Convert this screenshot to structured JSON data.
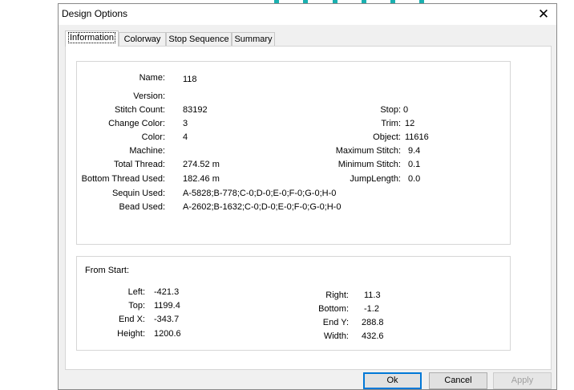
{
  "dialog": {
    "title": "Design Options",
    "close_icon": "close-icon"
  },
  "tabs": [
    {
      "label": "Information",
      "active": true
    },
    {
      "label": "Colorway",
      "active": false
    },
    {
      "label": "Stop Sequence",
      "active": false
    },
    {
      "label": "Summary",
      "active": false
    }
  ],
  "info": {
    "name": {
      "label": "Name:",
      "value": "118"
    },
    "version": {
      "label": "Version:",
      "value": ""
    },
    "stitch_count": {
      "label": "Stitch Count:",
      "value": "83192"
    },
    "change_color": {
      "label": "Change Color:",
      "value": "3"
    },
    "color": {
      "label": "Color:",
      "value": "4"
    },
    "machine": {
      "label": "Machine:",
      "value": ""
    },
    "total_thread": {
      "label": "Total Thread:",
      "value": "274.52 m"
    },
    "bottom_thread": {
      "label": "Bottom Thread Used:",
      "value": "182.46 m"
    },
    "sequin_used": {
      "label": "Sequin Used:",
      "value": "A-5828;B-778;C-0;D-0;E-0;F-0;G-0;H-0"
    },
    "bead_used": {
      "label": "Bead Used:",
      "value": "A-2602;B-1632;C-0;D-0;E-0;F-0;G-0;H-0"
    },
    "stop": {
      "label": "Stop:",
      "value": "0"
    },
    "trim": {
      "label": "Trim:",
      "value": "12"
    },
    "object": {
      "label": "Object:",
      "value": "11616"
    },
    "max_stitch": {
      "label": "Maximum Stitch:",
      "value": "9.4"
    },
    "min_stitch": {
      "label": "Minimum Stitch:",
      "value": "0.1"
    },
    "jump_length": {
      "label": "JumpLength:",
      "value": "0.0"
    }
  },
  "from_start": {
    "heading": "From Start:",
    "left": {
      "label": "Left:",
      "value": "-421.3"
    },
    "top": {
      "label": "Top:",
      "value": "1199.4"
    },
    "end_x": {
      "label": "End X:",
      "value": "-343.7"
    },
    "height": {
      "label": "Height:",
      "value": "1200.6"
    },
    "right": {
      "label": "Right:",
      "value": "11.3"
    },
    "bottom": {
      "label": "Bottom:",
      "value": "-1.2"
    },
    "end_y": {
      "label": "End Y:",
      "value": "288.8"
    },
    "width": {
      "label": "Width:",
      "value": "432.6"
    }
  },
  "buttons": {
    "ok": "Ok",
    "cancel": "Cancel",
    "apply": "Apply"
  },
  "colors": {
    "accent": "#0078d7",
    "teal": "#1ab0b0"
  }
}
